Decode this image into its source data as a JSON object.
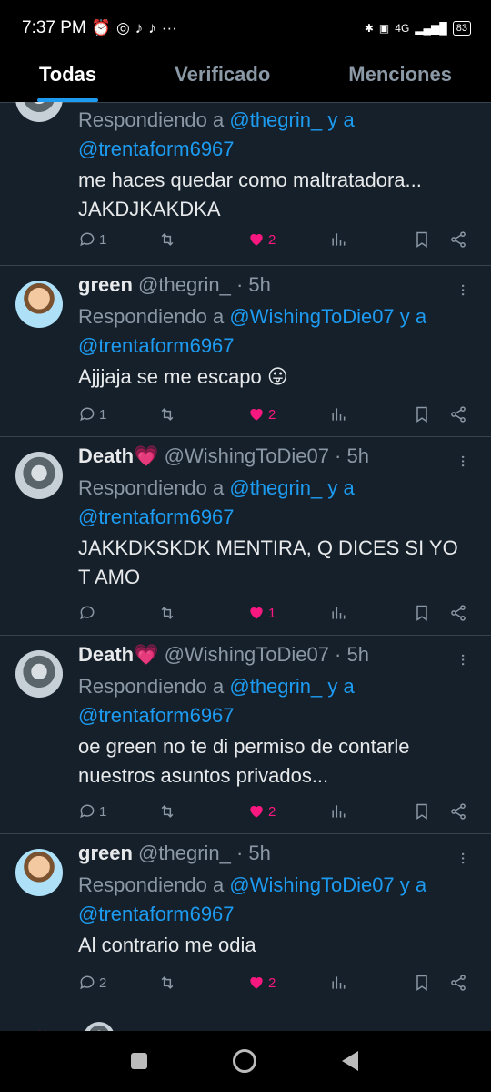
{
  "status_bar": {
    "time": "7:37 PM",
    "left_icons": [
      "alarm-icon",
      "whatsapp-icon",
      "tiktok-icon",
      "tiktok-icon",
      "more-dots-icon"
    ],
    "network": "4G",
    "battery": "83"
  },
  "tabs": [
    {
      "label": "Todas",
      "active": true
    },
    {
      "label": "Verificado",
      "active": false
    },
    {
      "label": "Menciones",
      "active": false
    }
  ],
  "tweets": [
    {
      "name": "",
      "handle": "",
      "time": "",
      "reply_prefix": "Respondiendo a",
      "reply_to": "@thegrin_",
      "reply_and": "y a",
      "reply_to_2": "@trentaform6967",
      "text_lines": [
        "me haces quedar como maltratadora...",
        "JAKDJKAKDKA"
      ],
      "replies": "1",
      "retweets": "",
      "likes": "2",
      "liked": true
    },
    {
      "name": "green",
      "handle": "@thegrin_ · 5h",
      "time": "",
      "reply_prefix": "Respondiendo a",
      "reply_to": "@WishingToDie07",
      "reply_and": "y a",
      "reply_to_2": "@trentaform6967",
      "text_lines": [
        "Ajjjaja se me escapo 😛"
      ],
      "replies": "1",
      "retweets": "",
      "likes": "2",
      "liked": true
    },
    {
      "name": "Death💗",
      "handle": "@WishingToDie07 · 5h",
      "time": "",
      "reply_prefix": "Respondiendo a",
      "reply_to": "@thegrin_",
      "reply_and": "y a",
      "reply_to_2": "@trentaform6967",
      "text_lines": [
        "JAKKDKSKDK MENTIRA, Q DICES SI YO",
        "T AMO"
      ],
      "replies": "",
      "retweets": "",
      "likes": "1",
      "liked": true
    },
    {
      "name": "Death💗",
      "handle": "@WishingToDie07 · 5h",
      "time": "",
      "reply_prefix": "Respondiendo a",
      "reply_to": "@thegrin_",
      "reply_and": "y a",
      "reply_to_2": "@trentaform6967",
      "text_lines": [
        "oe green no te di permiso de contarle",
        "nuestros asuntos privados..."
      ],
      "replies": "1",
      "retweets": "",
      "likes": "2",
      "liked": true
    },
    {
      "name": "green",
      "handle": "@thegrin_ · 5h",
      "time": "",
      "reply_prefix": "Respondiendo a",
      "reply_to": "@WishingToDie07",
      "reply_and": "y a",
      "reply_to_2": "@trentaform6967",
      "text_lines": [
        "Al contrario me odia"
      ],
      "replies": "2",
      "retweets": "",
      "likes": "2",
      "liked": true
    }
  ],
  "colors": {
    "background": "#15202b",
    "accent": "#1d9bf0",
    "like": "#f91880",
    "muted": "#8b98a5"
  },
  "nav_icons": [
    "recents-square-icon",
    "home-circle-icon",
    "back-triangle-icon"
  ]
}
